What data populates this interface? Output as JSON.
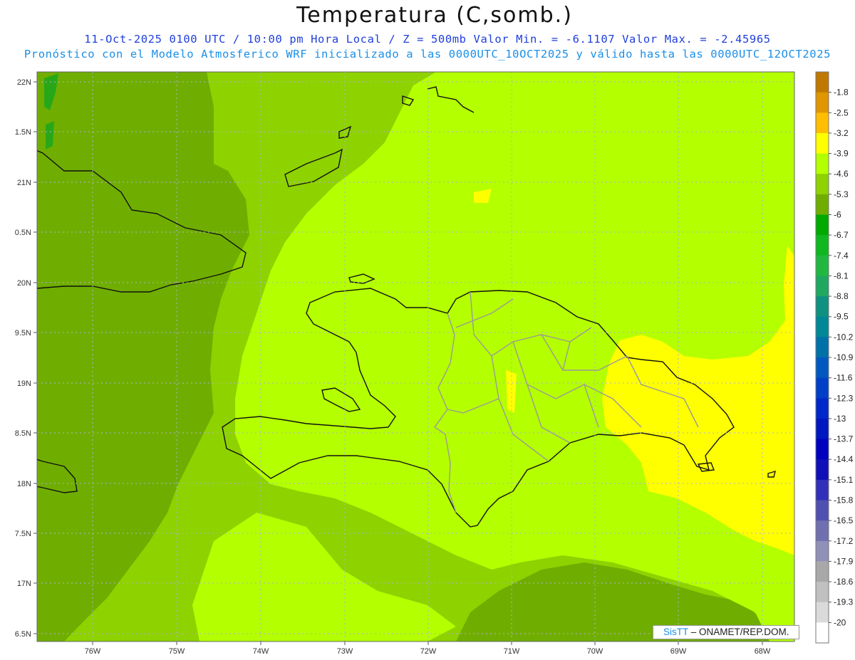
{
  "header": {
    "title": "Temperatura (C,somb.)",
    "subtitle_1": "11-Oct-2025  0100 UTC / 10:00 pm Hora Local / Z = 500mb  Valor Min. = -6.1107  Valor Max. = -2.45965",
    "subtitle_2": "Pronóstico con el Modelo Atmosferico WRF inicializado a las 0000UTC_10OCT2025 y válido hasta las  0000UTC_12OCT2025"
  },
  "credit": {
    "brand": "SisTT",
    "text": " – ONAMET/REP.DOM."
  },
  "map": {
    "lon_labels": [
      "76W",
      "75W",
      "74W",
      "73W",
      "72W",
      "71W",
      "70W",
      "69W",
      "68W"
    ],
    "lat_labels": [
      "22N",
      "1.5N",
      "21N",
      "0.5N",
      "20N",
      "9.5N",
      "19N",
      "8.5N",
      "18N",
      "7.5N",
      "17N",
      "6.5N"
    ],
    "field_colors": {
      "band_-6": "#6fae00",
      "band_-5.3": "#8ed200",
      "band_-4.6": "#b4ff00",
      "band_-3.9": "#ffff00",
      "band_-6.7": "#28a818"
    }
  },
  "colorbar": {
    "labels": [
      "-1.8",
      "-2.5",
      "-3.2",
      "-3.9",
      "-4.6",
      "-5.3",
      "-6",
      "-6.7",
      "-7.4",
      "-8.1",
      "-8.8",
      "-9.5",
      "-10.2",
      "-10.9",
      "-11.6",
      "-12.3",
      "-13",
      "-13.7",
      "-14.4",
      "-15.1",
      "-15.8",
      "-16.5",
      "-17.2",
      "-17.9",
      "-18.6",
      "-19.3",
      "-20"
    ],
    "colors": [
      "#c07800",
      "#e09600",
      "#ffbe00",
      "#ffff00",
      "#b4ff00",
      "#8ed200",
      "#6fae00",
      "#00aa00",
      "#10b820",
      "#20b840",
      "#20a860",
      "#109080",
      "#008898",
      "#0070a8",
      "#0058c0",
      "#0040c8",
      "#0028c8",
      "#0018c0",
      "#0000c0",
      "#1010b8",
      "#3030b8",
      "#5050b0",
      "#7070b0",
      "#9090b8",
      "#a8a8a8",
      "#c0c0c0",
      "#dadada",
      "#ffffff"
    ]
  }
}
